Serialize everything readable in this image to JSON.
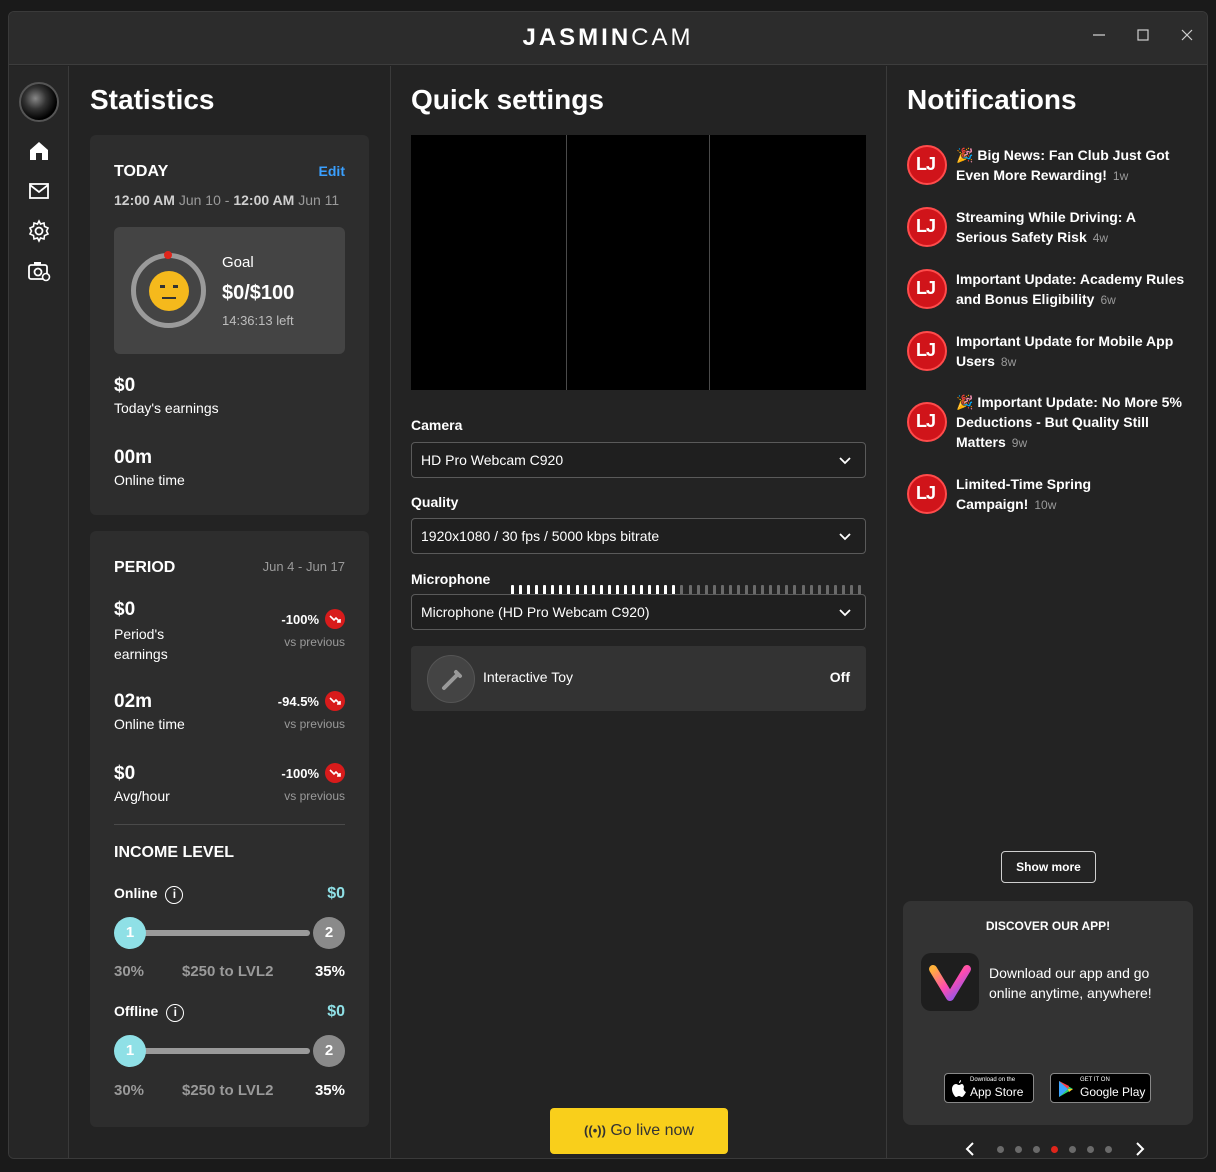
{
  "app": {
    "brand_bold": "JASMIN",
    "brand_light": "CAM",
    "controls": [
      "minimize",
      "maximize",
      "close"
    ]
  },
  "nav": {
    "items": [
      "home-icon",
      "mail-icon",
      "gear-icon",
      "camera-settings-icon"
    ]
  },
  "stats": {
    "title": "Statistics",
    "today": {
      "label": "TODAY",
      "edit": "Edit",
      "range_start_time": "12:00 AM",
      "range_start_date": "Jun 10",
      "range_sep": "-",
      "range_end_time": "12:00 AM",
      "range_end_date": "Jun 11",
      "goal_label": "Goal",
      "goal_value": "$0/$100",
      "goal_time_left": "14:36:13 left",
      "earnings_value": "$0",
      "earnings_label": "Today's earnings",
      "online_value": "00m",
      "online_label": "Online time"
    },
    "period": {
      "label": "PERIOD",
      "range": "Jun 4 - Jun 17",
      "rows": [
        {
          "value": "$0",
          "label": "Period's earnings",
          "pct": "-100%",
          "vs": "vs previous"
        },
        {
          "value": "02m",
          "label": "Online time",
          "pct": "-94.5%",
          "vs": "vs previous"
        },
        {
          "value": "$0",
          "label": "Avg/hour",
          "pct": "-100%",
          "vs": "vs previous"
        }
      ]
    },
    "income": {
      "label": "INCOME LEVEL",
      "levels": [
        {
          "name": "Online",
          "amount": "$0",
          "knob1": "1",
          "knob2": "2",
          "left_pct": "30%",
          "mid": "$250 to LVL2",
          "right_pct": "35%",
          "progress": 0
        },
        {
          "name": "Offline",
          "amount": "$0",
          "knob1": "1",
          "knob2": "2",
          "left_pct": "30%",
          "mid": "$250 to LVL2",
          "right_pct": "35%",
          "progress": 0
        }
      ]
    }
  },
  "quick": {
    "title": "Quick settings",
    "camera_label": "Camera",
    "camera_value": "HD Pro Webcam C920",
    "quality_label": "Quality",
    "quality_value": "1920x1080 / 30 fps / 5000 kbps bitrate",
    "mic_label": "Microphone",
    "mic_level": 0.47,
    "mic_value": "Microphone (HD Pro Webcam C920)",
    "toy_label": "Interactive Toy",
    "toy_state": "Off",
    "go_live": "Go live now"
  },
  "notifications": {
    "title": "Notifications",
    "items": [
      {
        "emoji": "🎉",
        "text": "Big News: Fan Club Just Got Even More Rewarding!",
        "age": "1w"
      },
      {
        "emoji": "",
        "text": "Streaming While Driving: A Serious Safety Risk",
        "age": "4w"
      },
      {
        "emoji": "",
        "text": "Important Update: Academy Rules and Bonus Eligibility",
        "age": "6w"
      },
      {
        "emoji": "",
        "text": "Important Update for Mobile App Users",
        "age": "8w"
      },
      {
        "emoji": "🎉",
        "text": "Important Update: No More 5% Deductions - But Quality Still Matters",
        "age": "9w"
      },
      {
        "emoji": "",
        "text": "Limited-Time Spring Campaign!",
        "age": "10w"
      }
    ],
    "show_more": "Show more",
    "app_promo": {
      "title": "DISCOVER OUR APP!",
      "text": "Download our app and go online anytime, anywhere!",
      "appstore_small": "Download on the",
      "appstore_big": "App Store",
      "play_small": "GET IT ON",
      "play_big": "Google Play",
      "carousel_total": 7,
      "carousel_active": 3
    }
  },
  "colors": {
    "accent_blue": "#3aa0ff",
    "teal": "#8fe0e6",
    "live_yellow": "#f9cf1b",
    "danger_red": "#d0141a"
  }
}
